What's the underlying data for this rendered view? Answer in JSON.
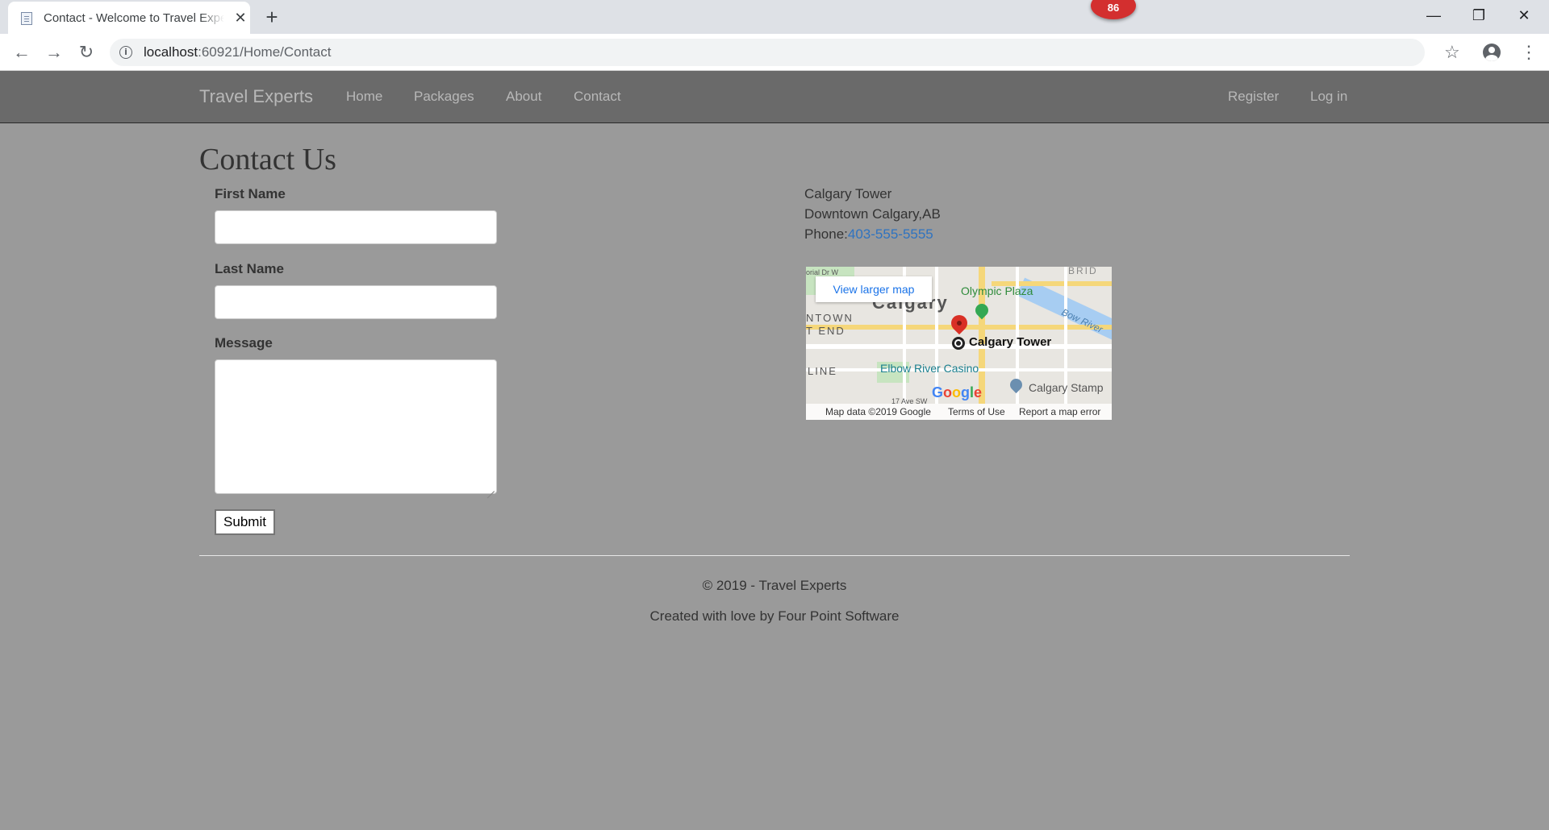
{
  "browser": {
    "tab_title": "Contact - Welcome to Travel Experts",
    "extension_badge": "86",
    "url_host": "localhost",
    "url_rest": ":60921/Home/Contact"
  },
  "nav": {
    "brand": "Travel Experts",
    "links": [
      "Home",
      "Packages",
      "About",
      "Contact"
    ],
    "right_links": [
      "Register",
      "Log in"
    ]
  },
  "page": {
    "title": "Contact Us"
  },
  "form": {
    "first_name_label": "First Name",
    "first_name_value": "",
    "last_name_label": "Last Name",
    "last_name_value": "",
    "message_label": "Message",
    "message_value": "",
    "submit_label": "Submit"
  },
  "contact_info": {
    "name": "Calgary Tower",
    "location": "Downtown Calgary,AB",
    "phone_label": "Phone:",
    "phone": "403-555-5555"
  },
  "map": {
    "view_larger": "View larger map",
    "labels": {
      "city": "Calgary",
      "downtown_1": "NTOWN",
      "downtown_2": "T END",
      "olympic": "Olympic Plaza",
      "bow": "Bow River",
      "tower": "Calgary Tower",
      "casino": "Elbow River Casino",
      "line": "LINE",
      "stampede": "Calgary Stamp",
      "street": "17 Ave SW",
      "corner": "orial Dr W",
      "bridge": "BRID"
    },
    "footer": {
      "data": "Map data ©2019 Google",
      "terms": "Terms of Use",
      "report": "Report a map error"
    }
  },
  "footer": {
    "copyright": "© 2019 - Travel Experts",
    "credit": "Created with love by Four Point Software"
  }
}
